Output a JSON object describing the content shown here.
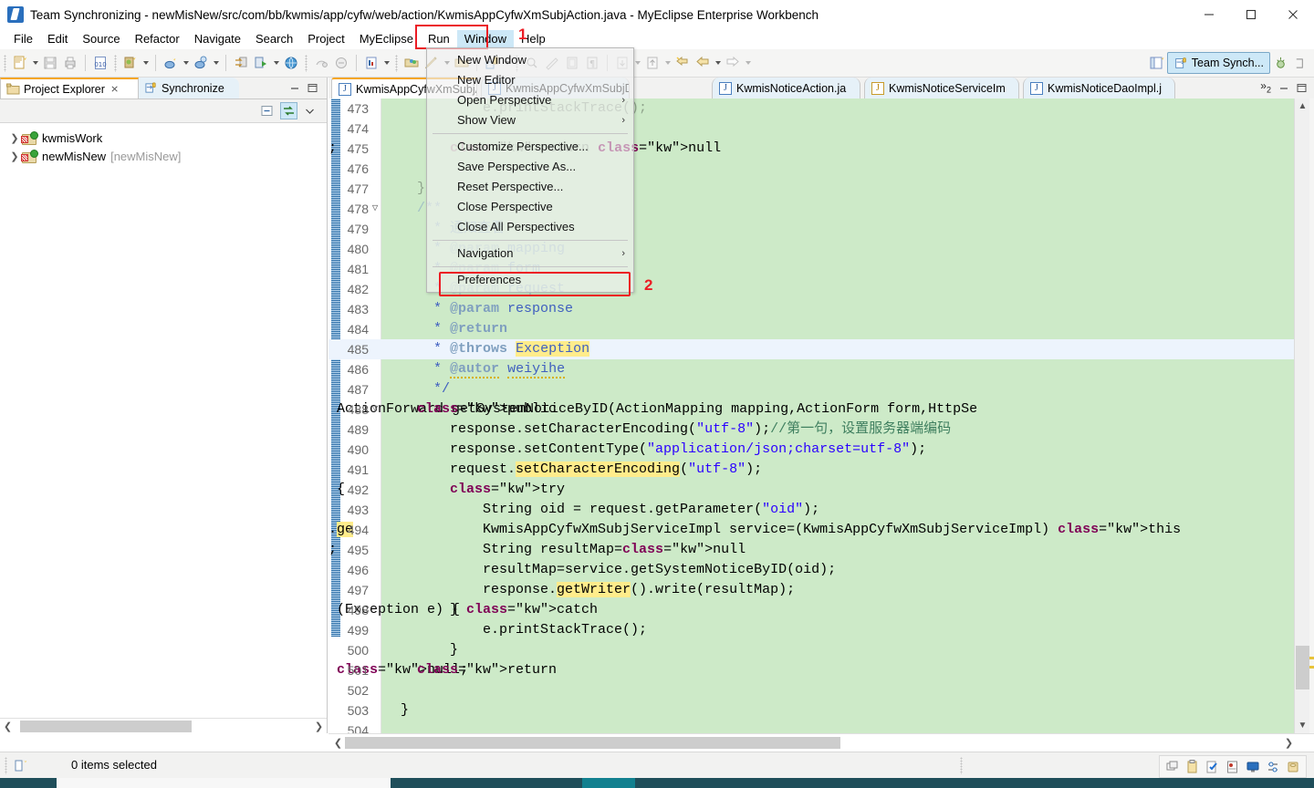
{
  "window": {
    "title": "Team Synchronizing - newMisNew/src/com/bb/kwmis/app/cyfw/web/action/KwmisAppCyfwXmSubjAction.java - MyEclipse Enterprise Workbench",
    "minimize": "─",
    "maximize": "□",
    "close": "✕"
  },
  "menubar": {
    "items": [
      {
        "label": "File",
        "active": false
      },
      {
        "label": "Edit",
        "active": false
      },
      {
        "label": "Source",
        "active": false
      },
      {
        "label": "Refactor",
        "active": false
      },
      {
        "label": "Navigate",
        "active": false
      },
      {
        "label": "Search",
        "active": false
      },
      {
        "label": "Project",
        "active": false
      },
      {
        "label": "MyEclipse",
        "active": false
      },
      {
        "label": "Run",
        "active": false
      },
      {
        "label": "Window",
        "active": true
      },
      {
        "label": "Help",
        "active": false
      }
    ]
  },
  "annotations": {
    "step1": "1",
    "step2": "2",
    "highlight_color": "#ec1c24"
  },
  "window_menu": {
    "items": [
      {
        "label": "New Window",
        "submenu": false
      },
      {
        "label": "New Editor",
        "submenu": false
      },
      {
        "label": "Open Perspective",
        "submenu": true
      },
      {
        "label": "Show View",
        "submenu": true
      },
      {
        "separator_after": true
      },
      {
        "label": "Customize Perspective...",
        "submenu": false
      },
      {
        "label": "Save Perspective As...",
        "submenu": false
      },
      {
        "label": "Reset Perspective...",
        "submenu": false
      },
      {
        "label": "Close Perspective",
        "submenu": false
      },
      {
        "label": "Close All Perspectives",
        "submenu": false
      },
      {
        "separator_after2": true
      },
      {
        "label": "Navigation",
        "submenu": true
      },
      {
        "label": "Preferences",
        "submenu": false
      }
    ],
    "submenu_glyph": "›"
  },
  "toolbar": {
    "perspective_active": "Team Synch...",
    "icons": [
      "new-wizard-icon",
      "save-icon",
      "print-icon",
      "toggle-ruler-icon",
      "new-java-class-icon",
      "debug-icon",
      "run-icon",
      "external-tools-icon",
      "open-type-icon",
      "search-icon",
      "next-annotation-icon",
      "previous-annotation-icon",
      "last-edit-location-icon",
      "back-icon",
      "forward-icon",
      "open-perspective-icon",
      "team-synchronize-icon"
    ]
  },
  "left_panel": {
    "tabs": [
      {
        "label": "Project Explorer",
        "selected": true,
        "icon": "project-explorer-icon",
        "close": "⨯"
      },
      {
        "label": "Synchronize",
        "selected": false,
        "icon": "synchronize-icon"
      }
    ],
    "view_toolbar": [
      "collapse-all-icon",
      "link-with-editor-icon",
      "view-menu-icon"
    ],
    "tree": [
      {
        "arrow": "❯",
        "label": "kwmisWork",
        "sub": "",
        "icon": "java-project-icon"
      },
      {
        "arrow": "❯",
        "label": "newMisNew",
        "sub": "[newMisNew]",
        "icon": "java-project-icon"
      }
    ]
  },
  "editor": {
    "tabs": [
      {
        "label": "KwmisAppCyfwXmSubjAc",
        "selected": true,
        "warn": false,
        "close": "⨯"
      },
      {
        "label": "KwmisAppCyfwXmSubjDA",
        "selected": false,
        "warn": false
      },
      {
        "label": "KwmisNoticeAction.ja",
        "selected": false,
        "warn": false
      },
      {
        "label": "KwmisNoticeServiceIm",
        "selected": false,
        "warn": true
      },
      {
        "label": "KwmisNoticeDaoImpl.j",
        "selected": false,
        "warn": false
      }
    ],
    "overflow": "»",
    "overflow_count": "2",
    "minimize": "─",
    "maximize": "□",
    "first_line": 473,
    "last_line": 504,
    "highlighted_line": 485,
    "code": [
      {
        "n": 473,
        "fold": "",
        "indent": 0,
        "html": "<span class=\"src-dim\">e.printStackTrace();</span>"
      },
      {
        "n": 474,
        "fold": "",
        "indent": 0,
        "html": ""
      },
      {
        "n": 475,
        "fold": "",
        "indent": 0,
        "html": "<span class=\"src-dim\">return null;</span>"
      },
      {
        "n": 476,
        "fold": "",
        "indent": 0,
        "html": ""
      },
      {
        "n": 477,
        "fold": "",
        "indent": 0,
        "html": "<span class=\"src-dim\">}</span>"
      },
      {
        "n": 478,
        "fold": "-",
        "indent": 0,
        "html": "<span class=\"src-dim\">/**</span>"
      },
      {
        "n": 479,
        "fold": "",
        "indent": 0,
        "html": "<span class=\"src-dim\"> * 通知查看</span>"
      },
      {
        "n": 480,
        "fold": "",
        "indent": 0,
        "html": "<span class=\"src-dim\"> * @param mapping</span>"
      },
      {
        "n": 481,
        "fold": "",
        "indent": 0,
        "html": "<span class=\"src-dim\"> * @param form</span>"
      },
      {
        "n": 482,
        "fold": "",
        "indent": 0,
        "html": "<span class=\"src-dim\"> * @param request</span>"
      },
      {
        "n": 483,
        "fold": "",
        "indent": 0,
        "html": " * @param response"
      },
      {
        "n": 484,
        "fold": "",
        "indent": 0,
        "html": " * @return"
      },
      {
        "n": 485,
        "fold": "",
        "indent": 0,
        "html": " * @throws Exception"
      },
      {
        "n": 486,
        "fold": "",
        "indent": 0,
        "html": " * @autor weiyihe"
      },
      {
        "n": 487,
        "fold": "",
        "indent": 0,
        "html": " */"
      },
      {
        "n": 488,
        "fold": "-",
        "indent": 0,
        "html": "public ActionForward getSystemNoticeByID(ActionMapping mapping,ActionForm form,HttpSe"
      },
      {
        "n": 489,
        "fold": "",
        "indent": 0,
        "html": "response.setCharacterEncoding(\"utf-8\");//第一句，设置服务器端编码"
      },
      {
        "n": 490,
        "fold": "",
        "indent": 0,
        "html": "response.setContentType(\"application/json;charset=utf-8\");"
      },
      {
        "n": 491,
        "fold": "",
        "indent": 0,
        "html": "request.setCharacterEncoding(\"utf-8\");"
      },
      {
        "n": 492,
        "fold": "",
        "indent": 0,
        "html": "try {"
      },
      {
        "n": 493,
        "fold": "",
        "indent": 0,
        "html": "String oid = request.getParameter(\"oid\");"
      },
      {
        "n": 494,
        "fold": "",
        "indent": 0,
        "html": "KwmisAppCyfwXmSubjServiceImpl service=(KwmisAppCyfwXmSubjServiceImpl) this.ge"
      },
      {
        "n": 495,
        "fold": "",
        "indent": 0,
        "html": "String resultMap=null;"
      },
      {
        "n": 496,
        "fold": "",
        "indent": 0,
        "html": "resultMap=service.getSystemNoticeByID(oid);"
      },
      {
        "n": 497,
        "fold": "",
        "indent": 0,
        "html": "response.getWriter().write(resultMap);"
      },
      {
        "n": 498,
        "fold": "",
        "indent": 0,
        "html": "} catch (Exception e) {"
      },
      {
        "n": 499,
        "fold": "",
        "indent": 0,
        "html": "e.printStackTrace();"
      },
      {
        "n": 500,
        "fold": "",
        "indent": 0,
        "html": "}"
      },
      {
        "n": 501,
        "fold": "",
        "indent": 0,
        "html": "return null;"
      },
      {
        "n": 502,
        "fold": "",
        "indent": 0,
        "html": ""
      },
      {
        "n": 503,
        "fold": "",
        "indent": 0,
        "html": "}"
      },
      {
        "n": 504,
        "fold": "",
        "indent": 0,
        "html": ""
      }
    ]
  },
  "statusbar": {
    "text": "0 items selected",
    "icon": "selection-icon",
    "right_icons": [
      "window-icon",
      "clipboard-icon",
      "tasks-icon",
      "server-icon",
      "console-icon",
      "filters-icon",
      "database-icon"
    ]
  },
  "colors": {
    "code_background": "#cdeac8",
    "selected_line": "#edf4fd",
    "occurrence_mark": "#ffec8b",
    "keyword": "#7f0055",
    "string": "#2a00ff",
    "comment": "#3f7f5f",
    "javadoc": "#3f5fbf",
    "accent_tab": "#f5a623",
    "accent_selection": "#cde8f7"
  }
}
